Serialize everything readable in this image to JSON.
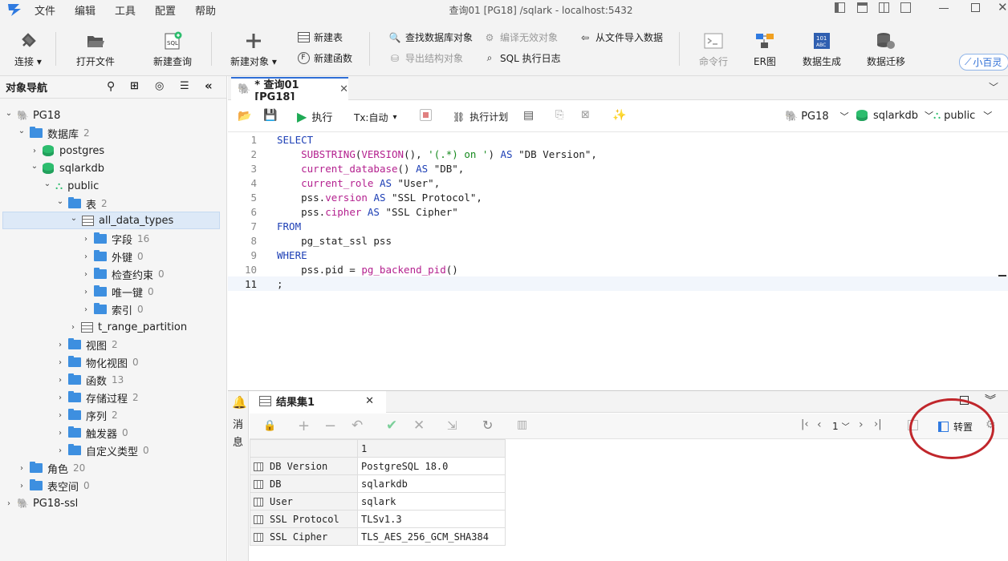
{
  "menu": [
    "文件",
    "编辑",
    "工具",
    "配置",
    "帮助"
  ],
  "window_title": "查询01 [PG18] /sqlark  - localhost:5432",
  "toolbar": {
    "connect": "连接",
    "open_file": "打开文件",
    "new_query": "新建查询",
    "new_object": "新建对象",
    "new_table": "新建表",
    "new_function": "新建函数",
    "find_db_object": "查找数据库对象",
    "compile_invalid": "编译无效对象",
    "import_data": "从文件导入数据",
    "export_structure": "导出结构对象",
    "sql_log": "SQL 执行日志",
    "command_line": "命令行",
    "er_diagram": "ER图",
    "data_gen": "数据生成",
    "data_migrate": "数据迁移",
    "assistant": "小百灵"
  },
  "nav": {
    "title": "对象导航",
    "tree": [
      {
        "label": "PG18",
        "count": "",
        "depth": 0,
        "icon": "pg",
        "open": true
      },
      {
        "label": "数据库",
        "count": "2",
        "depth": 1,
        "icon": "folder",
        "open": true
      },
      {
        "label": "postgres",
        "count": "",
        "depth": 2,
        "icon": "db",
        "open": false
      },
      {
        "label": "sqlarkdb",
        "count": "",
        "depth": 2,
        "icon": "db",
        "open": true
      },
      {
        "label": "public",
        "count": "",
        "depth": 3,
        "icon": "schema",
        "open": true
      },
      {
        "label": "表",
        "count": "2",
        "depth": 4,
        "icon": "folder",
        "open": true
      },
      {
        "label": "all_data_types",
        "count": "",
        "depth": 5,
        "icon": "table",
        "open": true,
        "selected": true
      },
      {
        "label": "字段",
        "count": "16",
        "depth": 6,
        "icon": "folder",
        "open": false
      },
      {
        "label": "外键",
        "count": "0",
        "depth": 6,
        "icon": "folder",
        "open": false
      },
      {
        "label": "检查约束",
        "count": "0",
        "depth": 6,
        "icon": "folder",
        "open": false
      },
      {
        "label": "唯一键",
        "count": "0",
        "depth": 6,
        "icon": "folder",
        "open": false
      },
      {
        "label": "索引",
        "count": "0",
        "depth": 6,
        "icon": "folder",
        "open": false
      },
      {
        "label": "t_range_partition",
        "count": "",
        "depth": 5,
        "icon": "table",
        "open": false
      },
      {
        "label": "视图",
        "count": "2",
        "depth": 4,
        "icon": "folder",
        "open": false
      },
      {
        "label": "物化视图",
        "count": "0",
        "depth": 4,
        "icon": "folder",
        "open": false
      },
      {
        "label": "函数",
        "count": "13",
        "depth": 4,
        "icon": "folder",
        "open": false
      },
      {
        "label": "存储过程",
        "count": "2",
        "depth": 4,
        "icon": "folder",
        "open": false
      },
      {
        "label": "序列",
        "count": "2",
        "depth": 4,
        "icon": "folder",
        "open": false
      },
      {
        "label": "触发器",
        "count": "0",
        "depth": 4,
        "icon": "folder",
        "open": false
      },
      {
        "label": "自定义类型",
        "count": "0",
        "depth": 4,
        "icon": "folder",
        "open": false
      },
      {
        "label": "角色",
        "count": "20",
        "depth": 1,
        "icon": "folder",
        "open": false
      },
      {
        "label": "表空间",
        "count": "0",
        "depth": 1,
        "icon": "folder",
        "open": false
      },
      {
        "label": "PG18-ssl",
        "count": "",
        "depth": 0,
        "icon": "pg",
        "open": false
      }
    ]
  },
  "tab": {
    "label": "* 查询01 [PG18]"
  },
  "editor_toolbar": {
    "execute": "执行",
    "tx_mode": "Tx:自动",
    "explain_plan": "执行计划",
    "connection": "PG18",
    "database": "sqlarkdb",
    "schema": "public"
  },
  "sql_lines": [
    "SELECT",
    "    SUBSTRING(VERSION(), '(.*) on ') AS \"DB Version\",",
    "    current_database() AS \"DB\",",
    "    current_role AS \"User\",",
    "    pss.version AS \"SSL Protocol\",",
    "    pss.cipher AS \"SSL Cipher\"",
    "FROM",
    "    pg_stat_ssl pss",
    "WHERE",
    "    pss.pid = pg_backend_pid()",
    ";"
  ],
  "results": {
    "side_label": "消息",
    "tab_label": "结果集1",
    "page": "1",
    "transpose_label": "转置",
    "column_header": "1",
    "rows": [
      {
        "name": "DB Version",
        "value": "PostgreSQL 18.0"
      },
      {
        "name": "DB",
        "value": "sqlarkdb"
      },
      {
        "name": "User",
        "value": "sqlark"
      },
      {
        "name": "SSL Protocol",
        "value": "TLSv1.3"
      },
      {
        "name": "SSL Cipher",
        "value": "TLS_AES_256_GCM_SHA384"
      }
    ]
  }
}
